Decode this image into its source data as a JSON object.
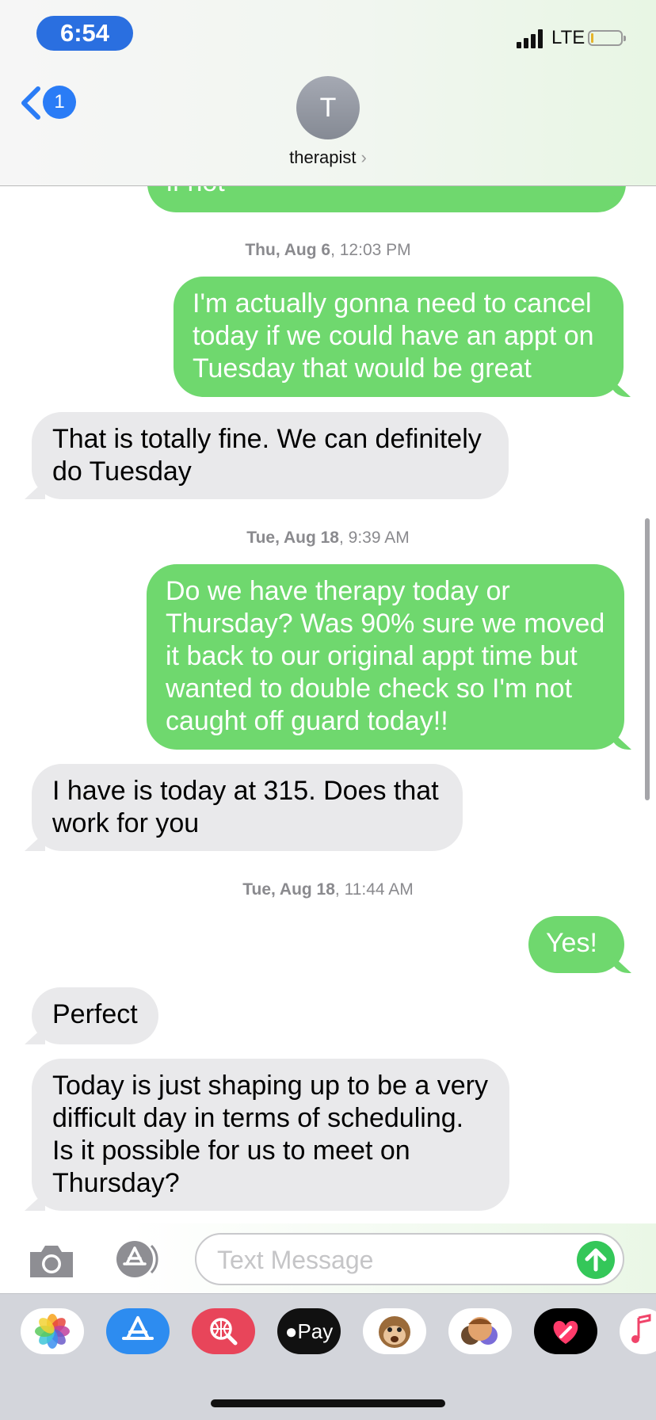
{
  "status": {
    "time": "6:54",
    "network": "LTE"
  },
  "nav": {
    "back_badge": "1",
    "avatar_initial": "T",
    "contact_name": "therapist",
    "chevron": "›"
  },
  "thread": {
    "partial_text": "if not",
    "timestamps": [
      {
        "day": "Thu, Aug 6",
        "time": ", 12:03 PM"
      },
      {
        "day": "Tue, Aug 18",
        "time": ", 9:39 AM"
      },
      {
        "day": "Tue, Aug 18",
        "time": ", 11:44 AM"
      }
    ],
    "messages": [
      {
        "sender": "me",
        "text": "I'm actually gonna need to cancel today if we could have an appt on Tuesday that would be great"
      },
      {
        "sender": "them",
        "text": "That is totally fine. We can definitely do Tuesday"
      },
      {
        "sender": "me",
        "text": "Do we have therapy today or Thursday? Was 90% sure we moved it back to our original appt time but wanted to double check so I'm not caught off guard today!!"
      },
      {
        "sender": "them",
        "text": "I have is today at 315. Does that work for you"
      },
      {
        "sender": "me",
        "text": "Yes!"
      },
      {
        "sender": "them",
        "text": "Perfect"
      },
      {
        "sender": "them",
        "text": "Today is just shaping up to be a very difficult day in terms of scheduling. Is it possible for us to meet on Thursday?"
      }
    ]
  },
  "composer": {
    "placeholder": "Text Message"
  },
  "drawer": {
    "apps": [
      {
        "icon": "photos-icon"
      },
      {
        "icon": "app-store-icon"
      },
      {
        "icon": "web-images-icon"
      },
      {
        "icon": "apple-pay-icon",
        "label": "Pay"
      },
      {
        "icon": "animoji-icon"
      },
      {
        "icon": "memoji-stickers-icon"
      },
      {
        "icon": "digital-touch-icon"
      },
      {
        "icon": "music-icon"
      }
    ]
  },
  "colors": {
    "outgoing_bubble": "#6fd86e",
    "incoming_bubble": "#e9e9eb",
    "accent_blue": "#2a7cf6",
    "time_pill": "#2a6fe0"
  }
}
